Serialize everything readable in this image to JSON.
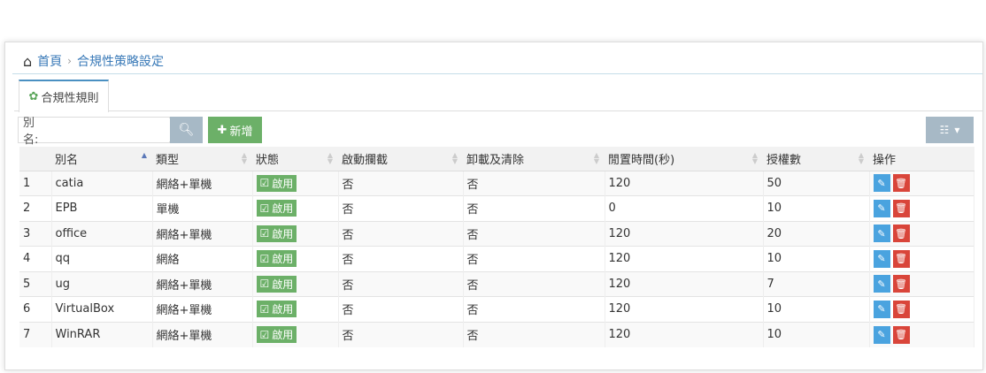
{
  "breadcrumb": {
    "home": "首頁",
    "current": "合規性策略設定"
  },
  "tab": {
    "label": "合規性規則"
  },
  "toolbar": {
    "search_label": "別名:",
    "search_value": "",
    "add_label": "新增"
  },
  "table": {
    "headers": [
      "別名",
      "類型",
      "狀態",
      "啟動攔截",
      "卸載及清除",
      "閒置時間(秒)",
      "授權數",
      "操作"
    ],
    "rows": [
      {
        "no": "1",
        "name": "catia",
        "type": "網絡+單機",
        "status": "啟用",
        "block": "否",
        "uninstall": "否",
        "idle": "120",
        "licenses": "50"
      },
      {
        "no": "2",
        "name": "EPB",
        "type": "單機",
        "status": "啟用",
        "block": "否",
        "uninstall": "否",
        "idle": "0",
        "licenses": "10"
      },
      {
        "no": "3",
        "name": "office",
        "type": "網絡+單機",
        "status": "啟用",
        "block": "否",
        "uninstall": "否",
        "idle": "120",
        "licenses": "20"
      },
      {
        "no": "4",
        "name": "qq",
        "type": "網絡",
        "status": "啟用",
        "block": "否",
        "uninstall": "否",
        "idle": "120",
        "licenses": "10"
      },
      {
        "no": "5",
        "name": "ug",
        "type": "網絡+單機",
        "status": "啟用",
        "block": "否",
        "uninstall": "否",
        "idle": "120",
        "licenses": "7"
      },
      {
        "no": "6",
        "name": "VirtualBox",
        "type": "網絡+單機",
        "status": "啟用",
        "block": "否",
        "uninstall": "否",
        "idle": "120",
        "licenses": "10"
      },
      {
        "no": "7",
        "name": "WinRAR",
        "type": "網絡+單機",
        "status": "啟用",
        "block": "否",
        "uninstall": "否",
        "idle": "120",
        "licenses": "10"
      }
    ]
  }
}
